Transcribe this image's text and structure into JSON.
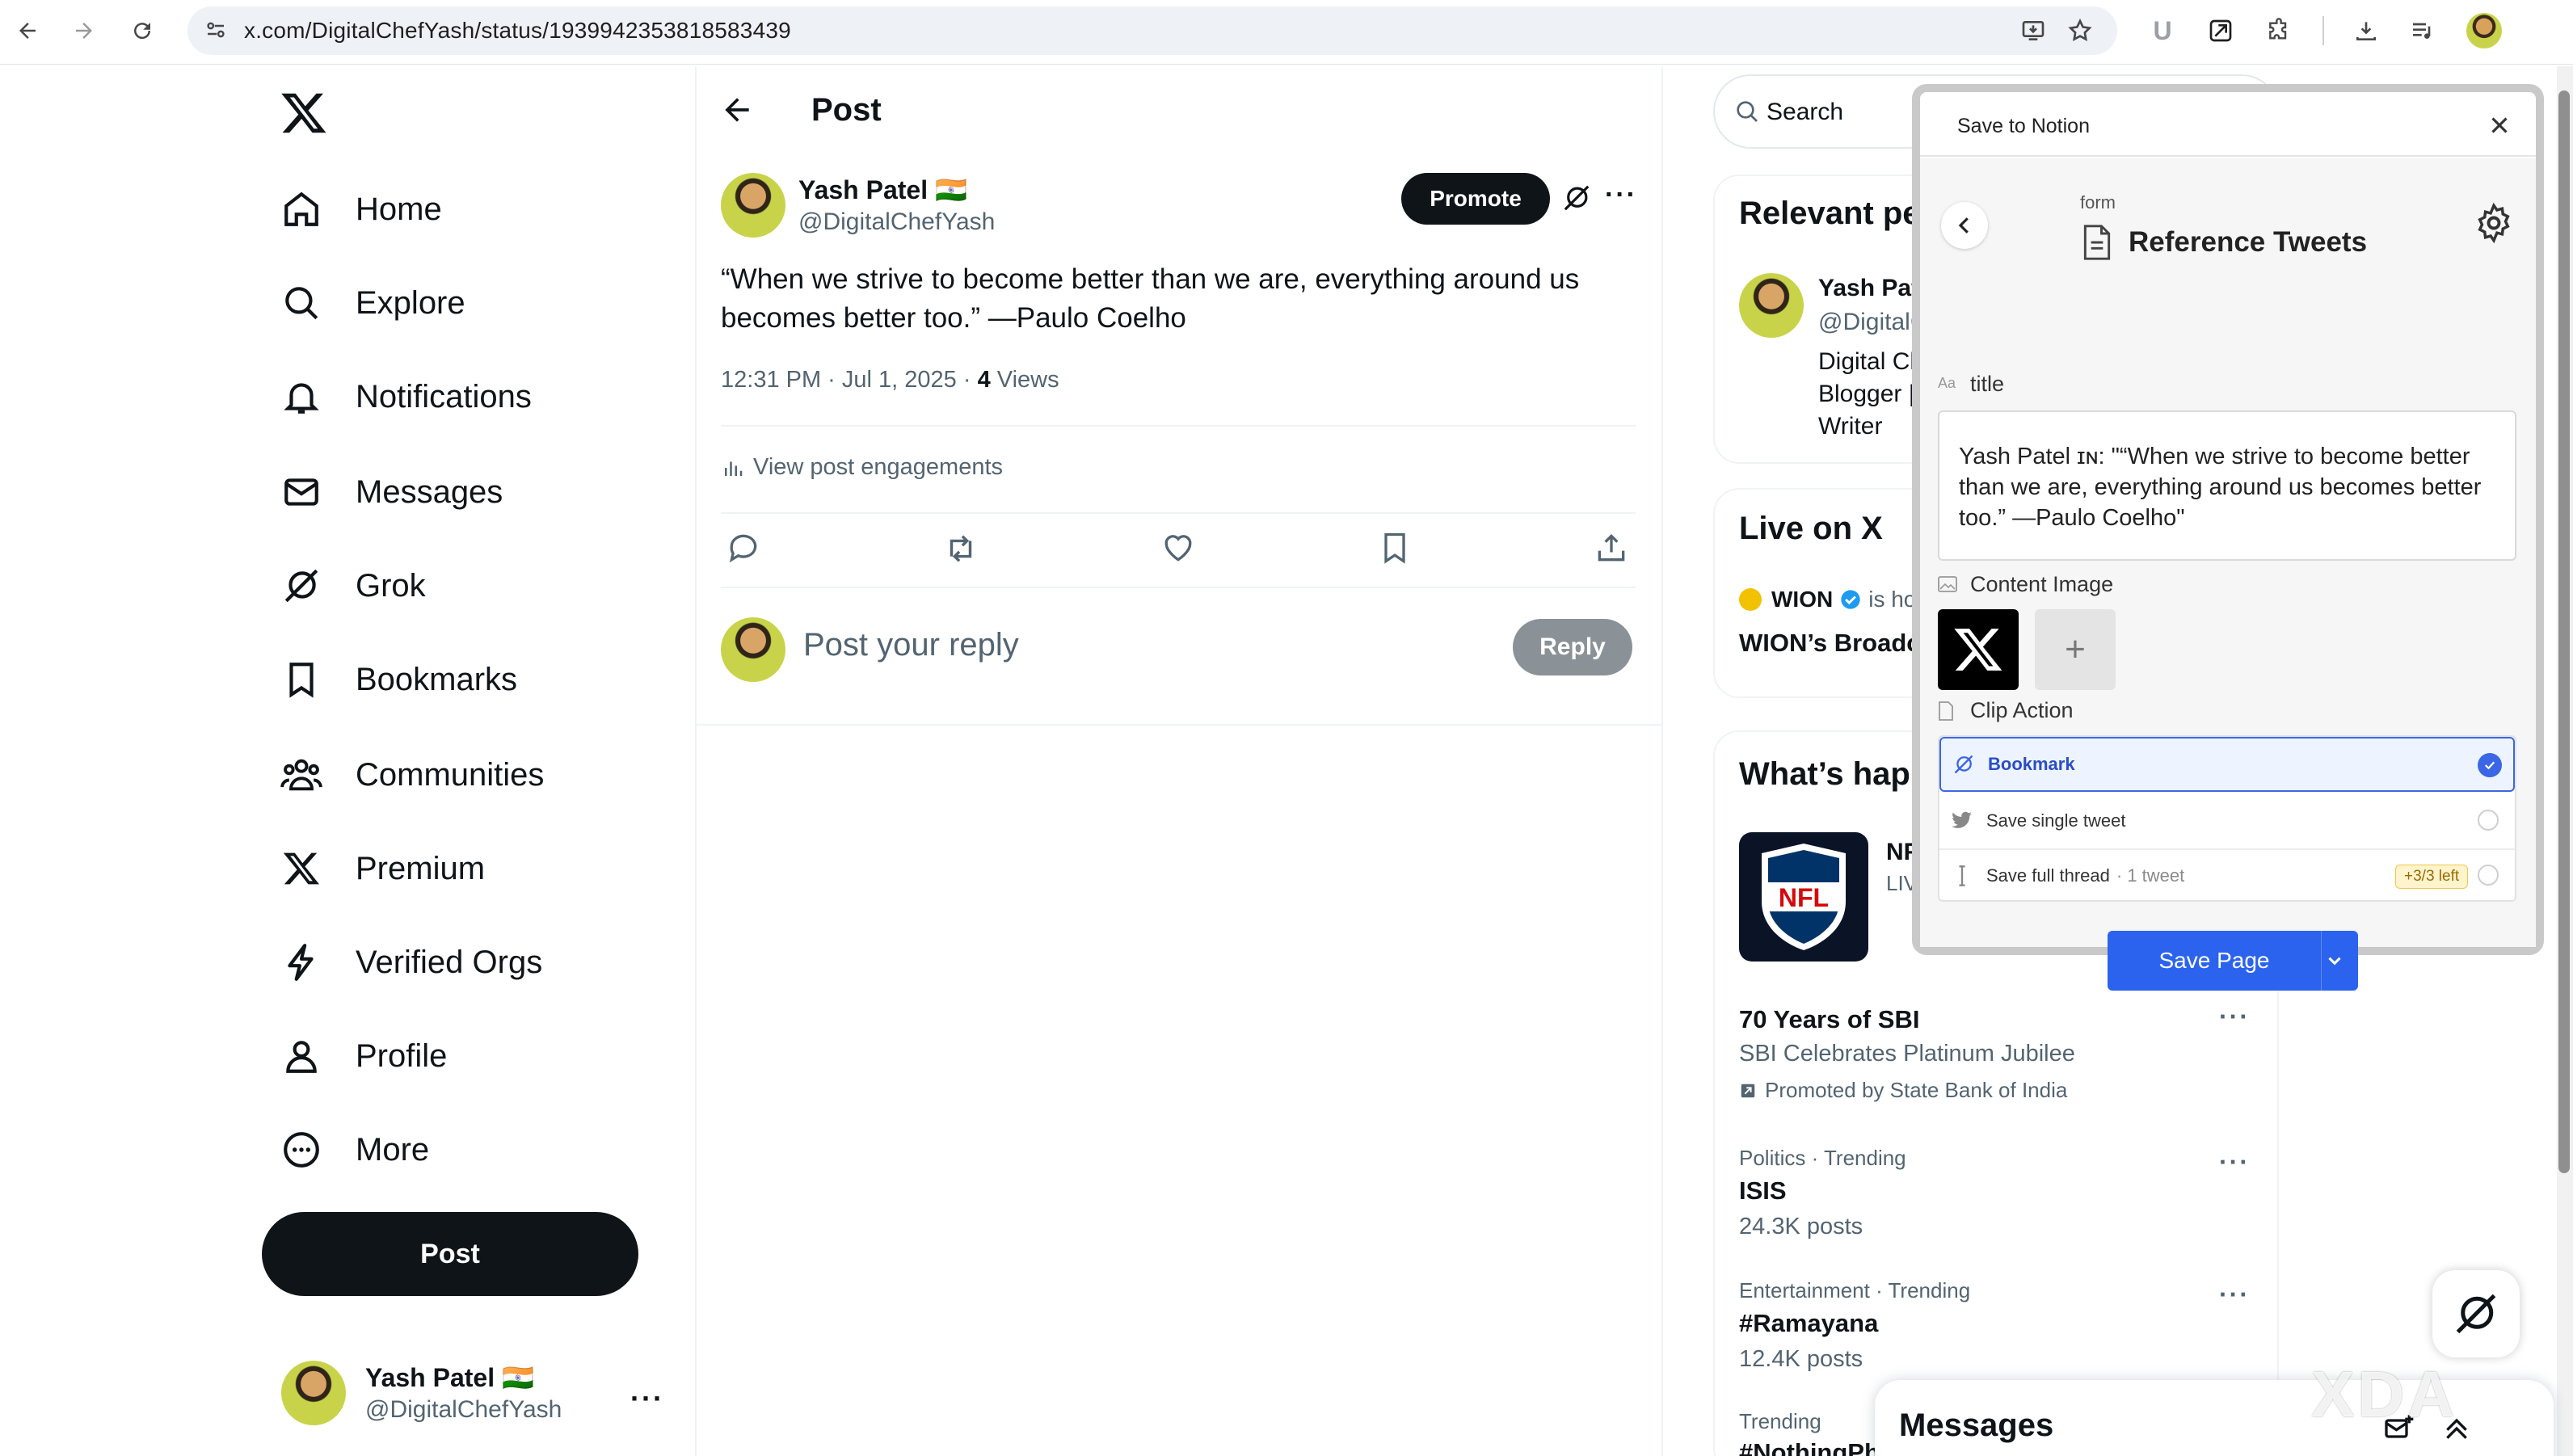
{
  "browser": {
    "url": "x.com/DigitalChefYash/status/1939942353818583439"
  },
  "nav": {
    "items": [
      {
        "label": "Home",
        "icon": "home-icon"
      },
      {
        "label": "Explore",
        "icon": "search-icon"
      },
      {
        "label": "Notifications",
        "icon": "bell-icon"
      },
      {
        "label": "Messages",
        "icon": "mail-icon"
      },
      {
        "label": "Grok",
        "icon": "grok-icon"
      },
      {
        "label": "Bookmarks",
        "icon": "bookmark-icon"
      },
      {
        "label": "Communities",
        "icon": "communities-icon"
      },
      {
        "label": "Premium",
        "icon": "x-icon"
      },
      {
        "label": "Verified Orgs",
        "icon": "lightning-icon"
      },
      {
        "label": "Profile",
        "icon": "person-icon"
      },
      {
        "label": "More",
        "icon": "more-circle-icon"
      }
    ],
    "post_button": "Post",
    "account": {
      "name": "Yash Patel 🇮🇳",
      "handle": "@DigitalChefYash"
    }
  },
  "main": {
    "header_title": "Post",
    "post": {
      "author_name": "Yash Patel 🇮🇳",
      "author_handle": "@DigitalChefYash",
      "promote_label": "Promote",
      "text": "“When we strive to become better than we are, everything around us becomes better too.” —Paulo Coelho",
      "meta_time": "12:31 PM · Jul 1, 2025 · ",
      "views_count": "4",
      "views_label": " Views",
      "engagements_label": "View post engagements"
    },
    "reply": {
      "placeholder": "Post your reply",
      "button": "Reply"
    }
  },
  "right": {
    "search_placeholder": "Search",
    "relevant": {
      "title": "Relevant pe",
      "name": "Yash Pat",
      "handle": "@DigitalC",
      "bio_lines": [
        "Digital Ch",
        "Blogger |",
        "Writer"
      ]
    },
    "live": {
      "title": "Live on X",
      "host": "WION",
      "host_suffix": "is hos",
      "broadcast": "WION’s Broadca"
    },
    "happening": {
      "title": "What’s hap",
      "featured_name": "NF",
      "featured_sub": "LIV",
      "trends": [
        {
          "context": "",
          "name": "70 Years of SBI",
          "sub": "SBI Celebrates Platinum Jubilee",
          "promo": "Promoted by State Bank of India"
        },
        {
          "context": "Politics · Trending",
          "name": "ISIS",
          "sub": "24.3K posts"
        },
        {
          "context": "Entertainment · Trending",
          "name": "#Ramayana",
          "sub": "12.4K posts"
        },
        {
          "context": "Trending",
          "name": "#NothingPh",
          "sub": ""
        }
      ]
    },
    "messages_title": "Messages"
  },
  "notion": {
    "header_title": "Save to Notion",
    "form_label": "form",
    "database_name": "Reference Tweets",
    "title_label": "title",
    "title_value": "Yash Patel ɪɴ: \"“When we strive to become better than we are, everything around us becomes better too.” —Paulo Coelho\"",
    "content_image_label": "Content Image",
    "clip_action_label": "Clip Action",
    "options": [
      {
        "label": "Bookmark",
        "selected": true
      },
      {
        "label": "Save single tweet",
        "selected": false
      },
      {
        "label": "Save full thread",
        "suffix": "· 1 tweet",
        "badge": "+3/3 left",
        "selected": false
      }
    ],
    "save_button": "Save Page",
    "watermark": "XDA",
    "accent_color": "#2b63ee"
  }
}
